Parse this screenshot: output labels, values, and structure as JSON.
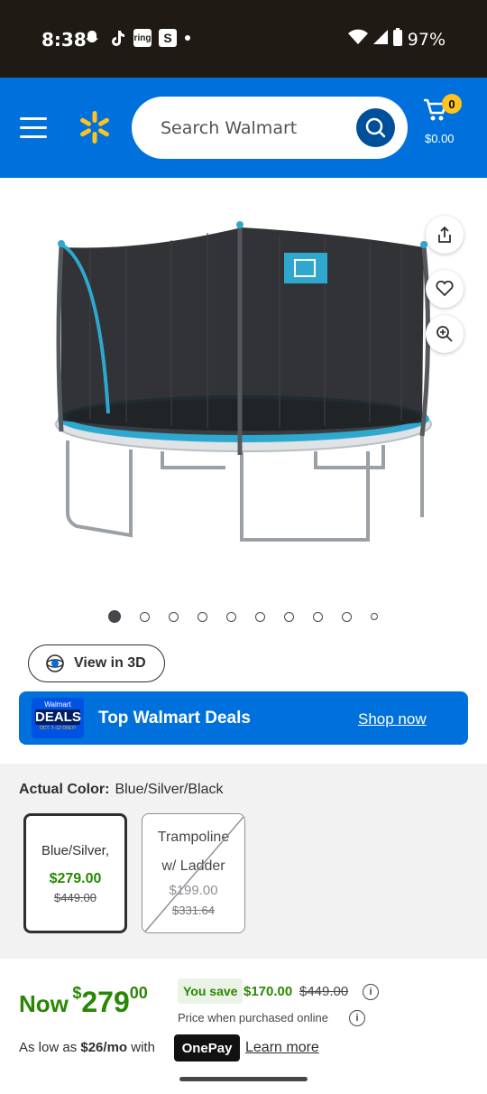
{
  "status": {
    "time": "8:38",
    "icons": [
      "snapchat-icon",
      "tiktok-icon",
      "ring-icon",
      "s-icon",
      "dot-icon"
    ],
    "ring_label": "ring",
    "s_label": "S",
    "battery": "97%"
  },
  "header": {
    "search_placeholder": "Search Walmart",
    "cart_count": "0",
    "cart_total": "$0.00",
    "brand_color": "#0071dc"
  },
  "gallery": {
    "image_alt": "Trampoline with enclosure net and basketball hoop",
    "page_count": 10,
    "active_index": 0
  },
  "view3d": {
    "label": "View in 3D"
  },
  "deals": {
    "logo_top": "Walmart",
    "logo_main": "DEALS",
    "logo_sub": "OCT. 7–12 ONLY!",
    "title": "Top Walmart Deals",
    "link": "Shop now"
  },
  "variant": {
    "label": "Actual Color:",
    "value": "Blue/Silver/Black",
    "options": [
      {
        "name": "Blue/Silver,",
        "price": "$279.00",
        "was": "$449.00"
      },
      {
        "name_line1": "Trampoline",
        "name_line2": "w/ Ladder",
        "price": "$199.00",
        "was": "$331.64"
      }
    ]
  },
  "price": {
    "now_label": "Now",
    "currency": "$",
    "dollars": "279",
    "cents": "00",
    "save_label": "You save",
    "save_amount": "$170.00",
    "was": "$449.00",
    "online_note": "Price when purchased online",
    "as_low_prefix": "As low as",
    "monthly": "$26/mo",
    "with": "with",
    "onepay": "OnePay",
    "learn_more": "Learn more",
    "info_glyph": "i",
    "accent": "#2a8703"
  }
}
